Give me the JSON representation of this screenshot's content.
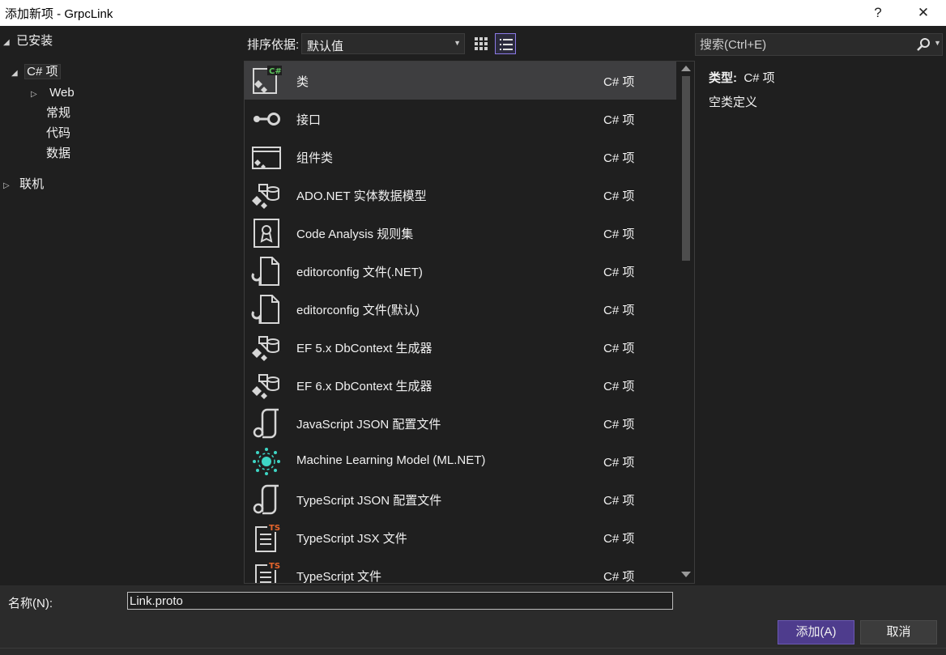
{
  "window": {
    "title": "添加新项 - GrpcLink",
    "help": "?",
    "close": "✕"
  },
  "tree": {
    "installed": "已安装",
    "csharp": "C# 项",
    "web": "Web",
    "general": "常规",
    "code": "代码",
    "data": "数据",
    "online": "联机"
  },
  "toolbar": {
    "sort_label": "排序依据:",
    "sort_value": "默认值",
    "search_placeholder": "搜索(Ctrl+E)"
  },
  "templates": [
    {
      "name": "类",
      "lang": "C# 项",
      "icon": "class-icon",
      "selected": true
    },
    {
      "name": "接口",
      "lang": "C# 项",
      "icon": "interface-icon"
    },
    {
      "name": "组件类",
      "lang": "C# 项",
      "icon": "component-class-icon"
    },
    {
      "name": "ADO.NET 实体数据模型",
      "lang": "C# 项",
      "icon": "entity-model-icon"
    },
    {
      "name": "Code Analysis 规则集",
      "lang": "C# 项",
      "icon": "ruleset-icon"
    },
    {
      "name": "editorconfig 文件(.NET)",
      "lang": "C# 项",
      "icon": "config-file-icon"
    },
    {
      "name": "editorconfig 文件(默认)",
      "lang": "C# 项",
      "icon": "config-file-icon"
    },
    {
      "name": "EF 5.x DbContext 生成器",
      "lang": "C# 项",
      "icon": "entity-model-icon"
    },
    {
      "name": "EF 6.x DbContext 生成器",
      "lang": "C# 项",
      "icon": "entity-model-icon"
    },
    {
      "name": "JavaScript JSON 配置文件",
      "lang": "C# 项",
      "icon": "json-config-icon"
    },
    {
      "name": "Machine Learning Model (ML.NET)",
      "lang": "C# 项",
      "icon": "ml-model-icon"
    },
    {
      "name": "TypeScript JSON 配置文件",
      "lang": "C# 项",
      "icon": "json-config-icon"
    },
    {
      "name": "TypeScript JSX 文件",
      "lang": "C# 项",
      "icon": "typescript-file-icon"
    },
    {
      "name": "TypeScript 文件",
      "lang": "C# 项",
      "icon": "typescript-file-icon"
    }
  ],
  "details": {
    "type_label": "类型:",
    "type_value": "C# 项",
    "description": "空类定义"
  },
  "footer": {
    "name_label": "名称(N):",
    "name_value": "Link.proto",
    "add_button": "添加(A)",
    "cancel_button": "取消"
  },
  "colors": {
    "background": "#1f1f1f",
    "selected_row": "#3e3e40",
    "accent": "#4e3c8d",
    "ts_badge": "#e8662c",
    "ml_teal": "#3ed6c5"
  }
}
